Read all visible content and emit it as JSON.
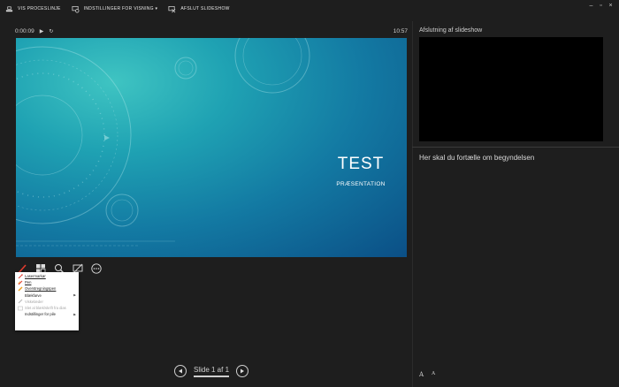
{
  "topbar": {
    "items": [
      {
        "label": "VIS PROCESLINJE",
        "icon": "taskbar-icon"
      },
      {
        "label": "INDSTILLINGER FOR VISNING ▾",
        "icon": "settings-display-icon"
      },
      {
        "label": "AFSLUT SLIDESHOW",
        "icon": "end-show-icon"
      }
    ],
    "window_controls": [
      "‒",
      "▫",
      "×"
    ]
  },
  "timer": {
    "elapsed": "0:00:09",
    "play_glyph": "▶",
    "reset_glyph": "↻",
    "clock": "10:57"
  },
  "slide": {
    "title": "TEST",
    "subtitle": "PRÆSENTATION"
  },
  "tools": [
    {
      "name": "pen-tool-icon"
    },
    {
      "name": "all-slides-icon"
    },
    {
      "name": "zoom-icon"
    },
    {
      "name": "black-screen-icon"
    },
    {
      "name": "more-options-icon"
    }
  ],
  "menu": {
    "items": [
      {
        "label": "Lasermarkør",
        "icon": "laser-pointer-icon",
        "underline": true
      },
      {
        "label": "Pen",
        "icon": "pen-icon",
        "underline": true
      },
      {
        "label": "Overstregningspen",
        "icon": "highlighter-icon",
        "underline": true
      },
      {
        "label": "Blækfarve",
        "submenu": true
      },
      {
        "label": "Viskelæder",
        "icon": "eraser-icon",
        "disabled": true
      },
      {
        "label": "Slet al blæk/skrift fra dias",
        "icon": "erase-all-icon",
        "disabled": true
      },
      {
        "label": "Indstillinger for pile",
        "submenu": true
      }
    ],
    "submenu_arrow": "▶"
  },
  "navigation": {
    "label": "Slide 1 af 1"
  },
  "next_slide": {
    "label": "Afslutning af slideshow"
  },
  "notes": {
    "text": "Her skal du fortælle om begyndelsen"
  },
  "font_controls": {
    "increase": "A",
    "decrease": "A"
  },
  "colors": {
    "background": "#1e1e1e",
    "pen_red": "#e23b2e",
    "slide_teal": "#1fa2b3",
    "slide_blue": "#0b4f86"
  }
}
